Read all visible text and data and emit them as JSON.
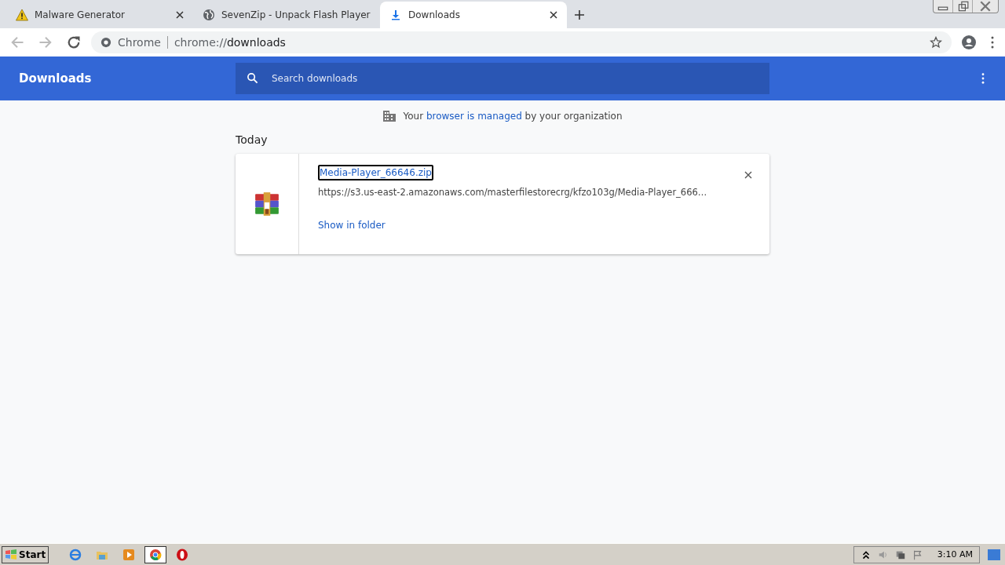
{
  "tabs": [
    {
      "title": "Malware Generator",
      "kind": "warning",
      "selected": false
    },
    {
      "title": "SevenZip - Unpack Flash Player",
      "kind": "globe",
      "selected": false
    },
    {
      "title": "Downloads",
      "kind": "download",
      "selected": true
    }
  ],
  "address": {
    "site": "Chrome",
    "url_prefix": "chrome://",
    "url_host": "downloads"
  },
  "header": {
    "title": "Downloads",
    "search": {
      "placeholder": "Search downloads"
    }
  },
  "managed_notice": {
    "before": "Your",
    "link": "browser is managed",
    "after": "by your organization"
  },
  "section": "Today",
  "downloads": [
    {
      "file_name": "Media-Player_66646.zip",
      "url": "https://s3.us-east-2.amazonaws.com/masterfilestorecrg/kfzo103g/Media-Player_666…",
      "action": "Show in folder"
    }
  ],
  "taskbar": {
    "start": "Start",
    "apps": [
      {
        "kind": "ie",
        "selected": false
      },
      {
        "kind": "explorer",
        "selected": false
      },
      {
        "kind": "media",
        "selected": false
      },
      {
        "kind": "chrome",
        "selected": true
      },
      {
        "kind": "opera",
        "selected": false
      }
    ],
    "clock": "3:10 AM"
  }
}
